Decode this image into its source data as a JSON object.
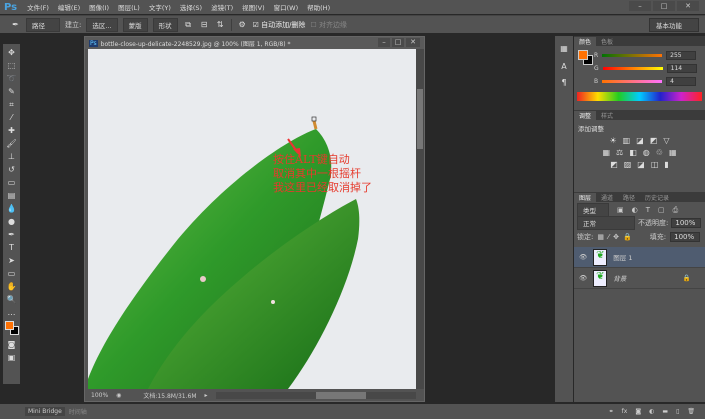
{
  "app": {
    "logo": "Ps",
    "menus": [
      "文件(F)",
      "编辑(E)",
      "图像(I)",
      "图层(L)",
      "文字(Y)",
      "选择(S)",
      "滤镜(T)",
      "视图(V)",
      "窗口(W)",
      "帮助(H)"
    ],
    "win_controls": [
      "–",
      "□",
      "✕"
    ]
  },
  "options": {
    "mode": "路径",
    "build_label": "建立:",
    "selection_btn": "选区...",
    "mask_btn": "蒙版",
    "shape_btn": "形状",
    "auto_add": "自动添加/删除",
    "align_edges": "对齐边缘",
    "workspace": "基本功能"
  },
  "document": {
    "title": "bottle-close-up-delicate-2248529.jpg @ 100% (图层 1, RGB/8) *",
    "zoom": "100%",
    "doc_size": "文档:15.8M/31.6M",
    "annotation": [
      "按住ALT键自动",
      "取消其中一根摇杆",
      "我这里已经取消掉了"
    ]
  },
  "color_panel": {
    "tabs": [
      "颜色",
      "色板"
    ],
    "r": "255",
    "g": "114",
    "b": "4",
    "labels": [
      "R",
      "G",
      "B"
    ],
    "fg": "#ff7204",
    "bg": "#000000"
  },
  "adjust_panel": {
    "tabs": [
      "调整",
      "样式"
    ],
    "title": "添加调整"
  },
  "layers_panel": {
    "tabs": [
      "图层",
      "通道",
      "路径",
      "历史记录"
    ],
    "filter": "类型",
    "blend": "正常",
    "opacity_label": "不透明度:",
    "opacity": "100%",
    "lock_label": "锁定:",
    "fill_label": "填充:",
    "fill": "100%",
    "layers": [
      {
        "name": "图层 1",
        "selected": true
      },
      {
        "name": "背景",
        "locked": true
      }
    ]
  },
  "bottom": {
    "tabs": [
      "Mini Bridge",
      "时间轴"
    ]
  }
}
